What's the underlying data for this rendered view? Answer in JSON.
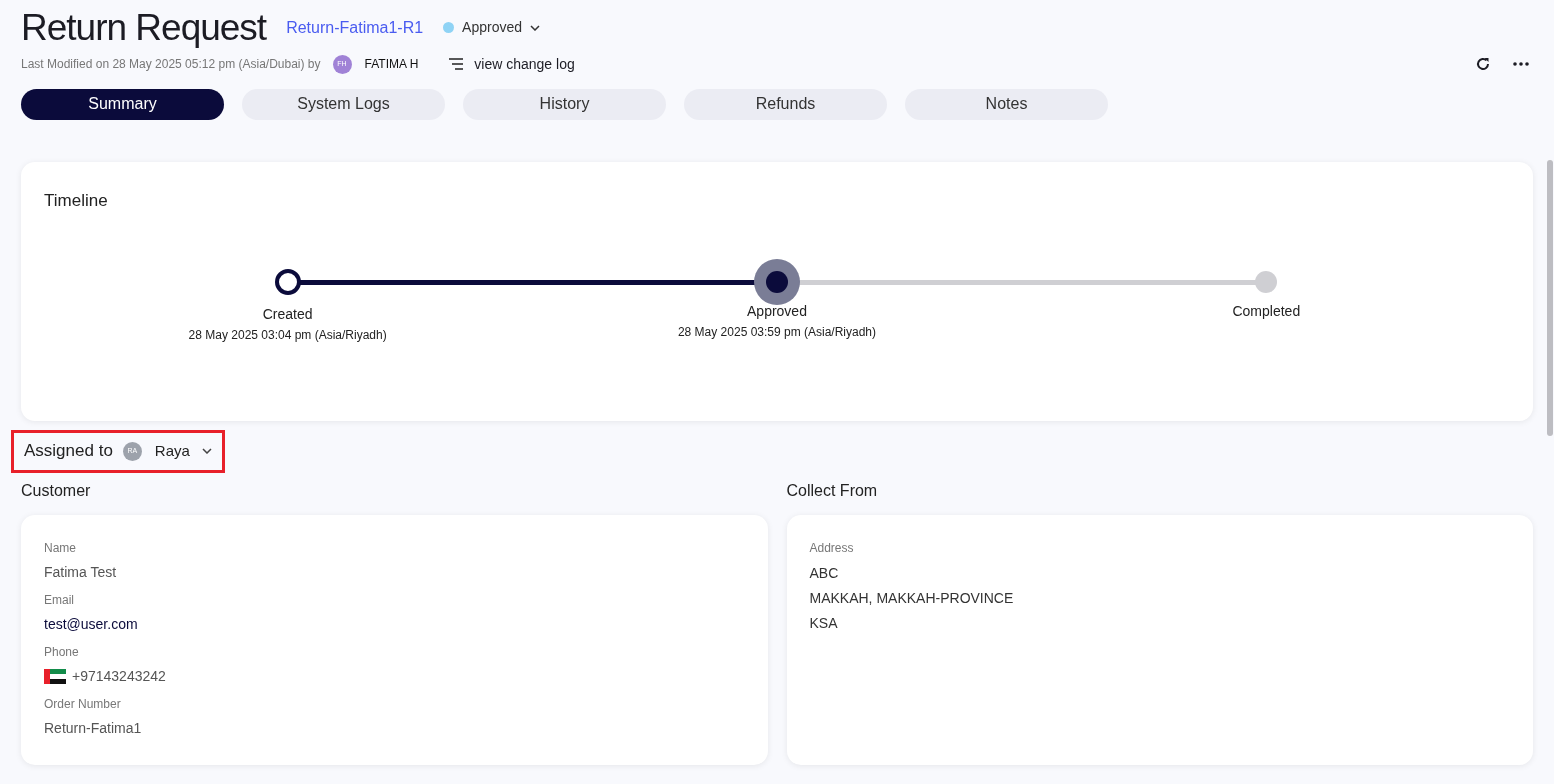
{
  "header": {
    "title": "Return Request",
    "reference": "Return-Fatima1-R1",
    "status": {
      "label": "Approved",
      "color": "#8fd3f5"
    },
    "modified_text": "Last Modified on 28 May 2025 05:12 pm (Asia/Dubai) by",
    "user_initials": "FH",
    "user_name": "FATIMA H",
    "change_log_link": "view change log"
  },
  "tabs": [
    {
      "label": "Summary",
      "selected": true
    },
    {
      "label": "System Logs",
      "selected": false
    },
    {
      "label": "History",
      "selected": false
    },
    {
      "label": "Refunds",
      "selected": false
    },
    {
      "label": "Notes",
      "selected": false
    }
  ],
  "timeline": {
    "title": "Timeline",
    "steps": [
      {
        "label": "Created",
        "date": "28 May 2025 03:04 pm (Asia/Riyadh)",
        "kind": "done"
      },
      {
        "label": "Approved",
        "date": "28 May 2025 03:59 pm (Asia/Riyadh)",
        "kind": "current"
      },
      {
        "label": "Completed",
        "kind": "pending"
      }
    ]
  },
  "assignment": {
    "label": "Assigned to",
    "initials": "RA",
    "name": "Raya",
    "highlighted": true
  },
  "customer": {
    "heading": "Customer",
    "fields": [
      {
        "label": "Name",
        "value": "Fatima Test",
        "kind": "text"
      },
      {
        "label": "Email",
        "value": "test@user.com",
        "kind": "email"
      },
      {
        "label": "Phone",
        "value": "+97143243242",
        "kind": "phone"
      },
      {
        "label": "Order Number",
        "value": "Return-Fatima1",
        "kind": "text"
      }
    ]
  },
  "collect_from": {
    "heading": "Collect From",
    "label": "Address",
    "lines": [
      "ABC",
      "MAKKAH, MAKKAH-PROVINCE",
      "KSA"
    ]
  }
}
